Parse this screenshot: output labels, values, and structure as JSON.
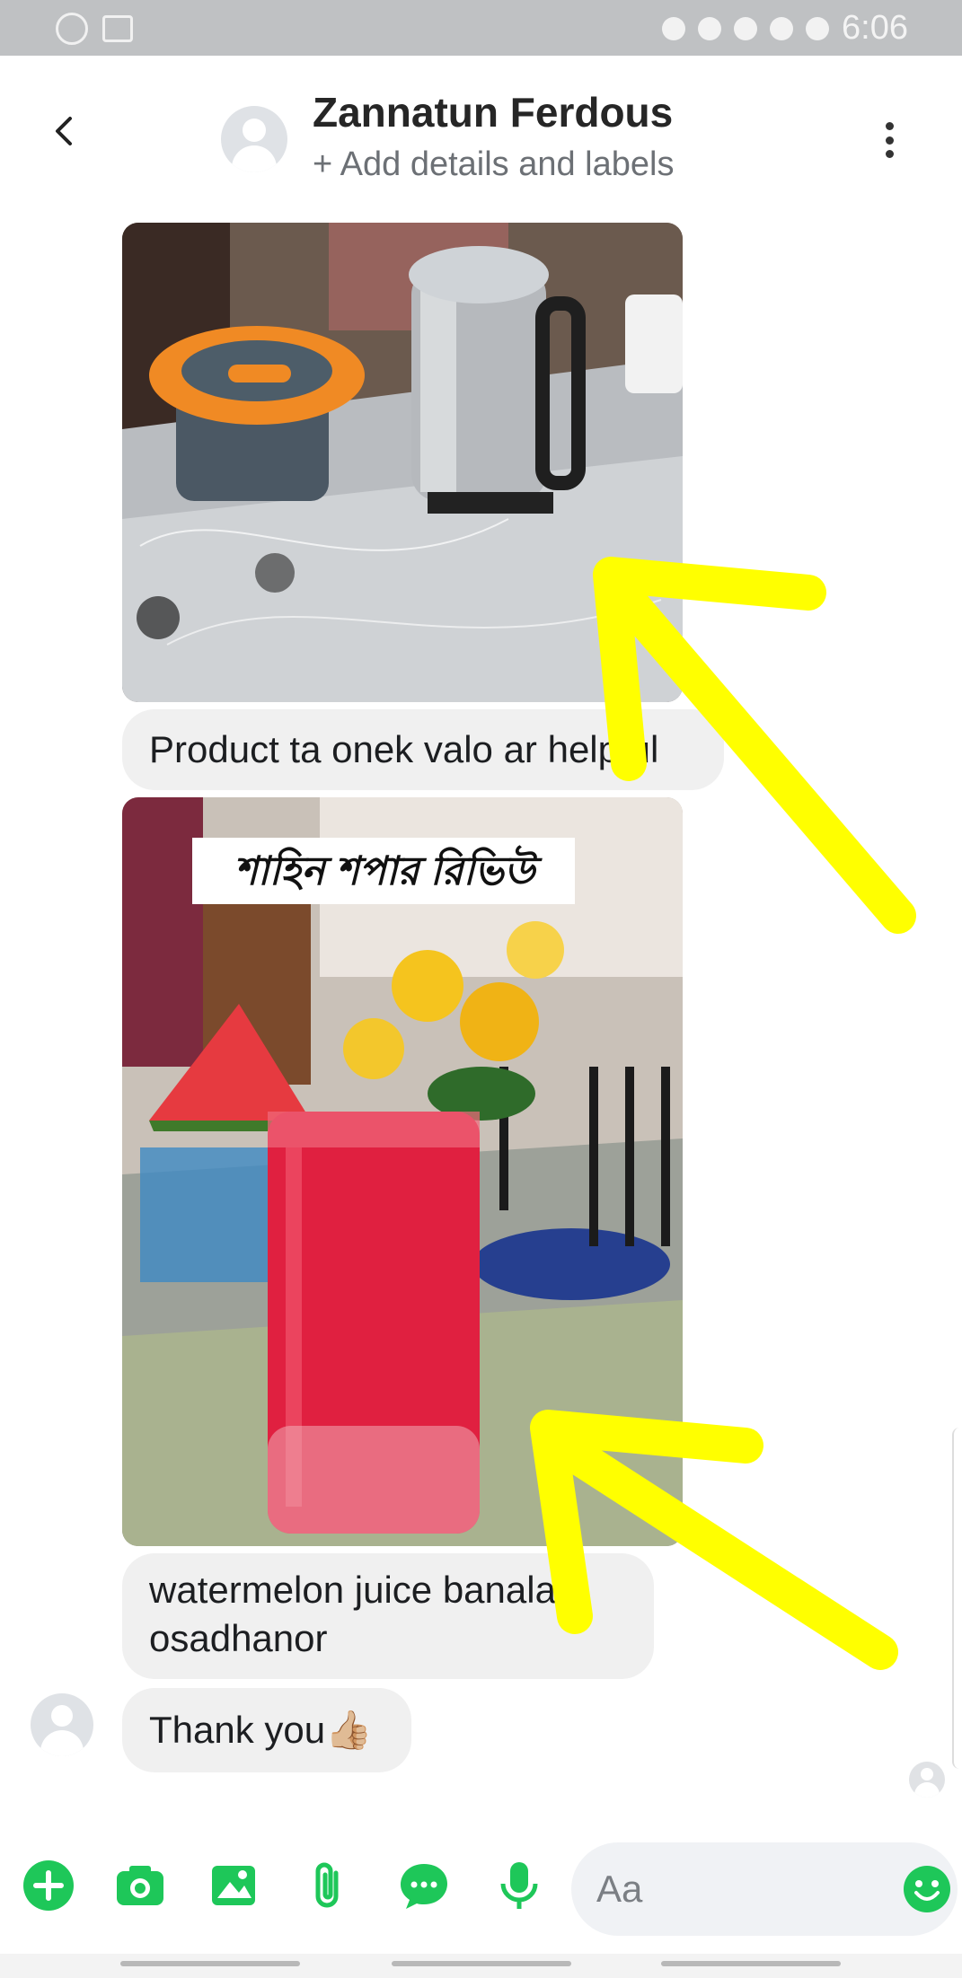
{
  "status_bar": {
    "time": "6:06"
  },
  "header": {
    "contact_name": "Zannatun Ferdous",
    "details_link": "+ Add details and labels",
    "icons": [
      "back-arrow-icon",
      "avatar-placeholder",
      "more-vertical-icon"
    ]
  },
  "messages": [
    {
      "type": "photo",
      "subject": "orange lidded container and stainless steel kettle on table"
    },
    {
      "type": "text",
      "text": "Product ta onek valo ar helpful"
    },
    {
      "type": "photo",
      "subject": "glass of watermelon juice with watermelon slice",
      "overlay_text": "শাহিন শপার রিভিউ"
    },
    {
      "type": "text",
      "line1": "watermelon juice banalam",
      "line2": "osadhanor"
    },
    {
      "type": "text",
      "text": "Thank you👍🏼"
    }
  ],
  "composer": {
    "placeholder": "Aa",
    "icons": [
      "plus-icon",
      "camera-icon",
      "gallery-icon",
      "attachment-icon",
      "chat-bubble-icon",
      "microphone-icon",
      "emoji-icon"
    ],
    "accent_color": "#1ec759"
  },
  "annotations": {
    "arrow_color": "#ffff00"
  }
}
